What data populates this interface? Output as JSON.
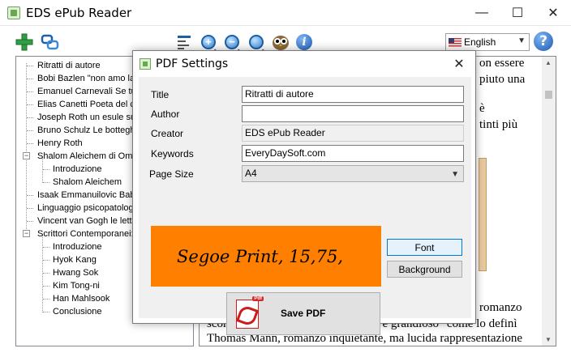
{
  "window": {
    "title": "EDS ePub Reader",
    "minimize": "—",
    "maximize": "☐",
    "close": "✕"
  },
  "toolbar": {
    "icons": [
      "add-icon",
      "link-icon",
      "text-size-icon",
      "zoom-in-icon",
      "zoom-out-icon",
      "zoom-fit-icon",
      "owl-icon",
      "info-icon"
    ],
    "zoom_in_glyph": "+",
    "zoom_out_glyph": "−",
    "info_glyph": "i",
    "language": "English",
    "help_glyph": "?"
  },
  "tree": {
    "items": [
      {
        "label": "Ritratti di autore",
        "level": 0
      },
      {
        "label": "Bobi Bazlen \"non amo la",
        "level": 0
      },
      {
        "label": "Emanuel Carnevali Se tu",
        "level": 0
      },
      {
        "label": "Elias Canetti Poeta del co",
        "level": 0
      },
      {
        "label": "Joseph Roth un esule su",
        "level": 0
      },
      {
        "label": "Bruno Schulz Le botteghe",
        "level": 0
      },
      {
        "label": "Henry Roth",
        "level": 0
      },
      {
        "label": "Shalom Aleichem di Ome",
        "level": 0,
        "expander": "−"
      },
      {
        "label": "Introduzione",
        "level": 1
      },
      {
        "label": "Shalom Aleichem",
        "level": 1
      },
      {
        "label": "Isaak Emmanuilovic Babe",
        "level": 0
      },
      {
        "label": "Linguaggio psicopatologi",
        "level": 0
      },
      {
        "label": "Vincent van Gogh le lette",
        "level": 0
      },
      {
        "label": "Scrittori Contemporanei: C",
        "level": 0,
        "expander": "−"
      },
      {
        "label": "Introduzione",
        "level": 1
      },
      {
        "label": "Hyok Kang",
        "level": 1
      },
      {
        "label": "Hwang Sok",
        "level": 1
      },
      {
        "label": "Kim Tong-ni",
        "level": 1
      },
      {
        "label": "Han Mahlsook",
        "level": 1
      },
      {
        "label": "Conclusione",
        "level": 1
      }
    ]
  },
  "reader": {
    "lines_top": [
      "on essere",
      "piuto una",
      "è",
      "tinti più"
    ],
    "lines_bottom": [
      "romanzo",
      "sconvolgente e profondo, \"protervo e grandioso\" come lo definì",
      "Thomas Mann, romanzo inquietante, ma lucida rappresentazione"
    ],
    "scroll_up": "▲",
    "scroll_down": "▼"
  },
  "dialog": {
    "title": "PDF Settings",
    "close": "✕",
    "fields": {
      "title_label": "Title",
      "title_value": "Ritratti di autore",
      "author_label": "Author",
      "author_value": "",
      "creator_label": "Creator",
      "creator_value": "EDS ePub Reader",
      "keywords_label": "Keywords",
      "keywords_value": "EveryDaySoft.com",
      "pagesize_label": "Page Size",
      "pagesize_value": "A4"
    },
    "font_preview": "Segoe Print, 15,75,",
    "font_button": "Font",
    "background_button": "Background",
    "save_button": "Save PDF",
    "pdf_tag": "Pdf"
  },
  "colors": {
    "preview_bg": "#ff8000",
    "accent": "#0078d7"
  }
}
